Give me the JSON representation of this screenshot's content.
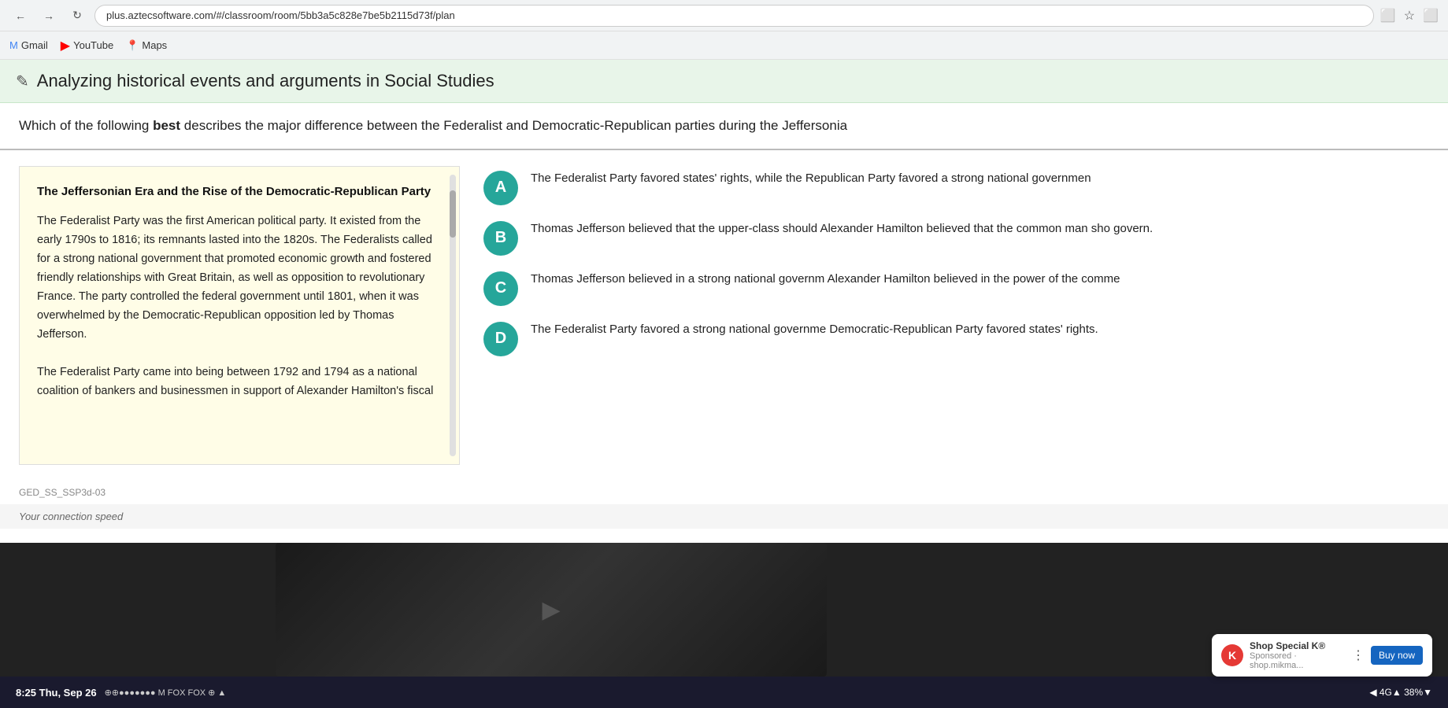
{
  "browser": {
    "url": "plus.aztecsoftware.com/#/classroom/room/5bb3a5c828e7be5b2115d73f/plan",
    "bookmarks": [
      {
        "label": "Gmail",
        "icon": "M",
        "type": "gmail"
      },
      {
        "label": "YouTube",
        "icon": "▶",
        "type": "youtube"
      },
      {
        "label": "Maps",
        "icon": "📍",
        "type": "maps"
      }
    ]
  },
  "page": {
    "title": "Analyzing historical events and arguments in Social Studies",
    "title_icon": "✎"
  },
  "question": {
    "text_plain": "Which of the following ",
    "text_bold": "best",
    "text_rest": " describes the major difference between the Federalist and Democratic-Republican parties during the Jeffersonia"
  },
  "passage": {
    "title": "The Jeffersonian Era and the Rise of the Democratic-Republican Party",
    "paragraphs": [
      "The Federalist Party was the first American political party. It existed from the early 1790s to 1816; its remnants lasted into the 1820s. The Federalists called for a strong national government that promoted economic growth and fostered friendly relationships with Great Britain, as well as opposition to revolutionary France. The party controlled the federal government until 1801, when it was overwhelmed by the Democratic-Republican opposition led by Thomas Jefferson.",
      "The Federalist Party came into being between 1792 and 1794 as a national coalition of bankers and businessmen in support of Alexander Hamilton's fiscal"
    ]
  },
  "answers": [
    {
      "letter": "A",
      "text": "The Federalist Party favored states' rights, while the Republican Party favored a strong national governmen"
    },
    {
      "letter": "B",
      "text": "Thomas Jefferson believed that the upper-class should Alexander Hamilton believed that the common man sho govern."
    },
    {
      "letter": "C",
      "text": "Thomas Jefferson believed in a strong national governm Alexander Hamilton believed in the power of the comme"
    },
    {
      "letter": "D",
      "text": "The Federalist Party favored a strong national governme Democratic-Republican Party favored states' rights."
    }
  ],
  "footer": {
    "standard": "GED_SS_SSP3d-03",
    "connection": "Your connection speed"
  },
  "notification_bar": {
    "time": "8:25  Thu, Sep 26",
    "signal": "◀ 4G▲  38%▼"
  },
  "ad": {
    "title": "Shop Special K®",
    "subtitle": "Sponsored · shop.mikma...",
    "button_label": "Buy now"
  }
}
